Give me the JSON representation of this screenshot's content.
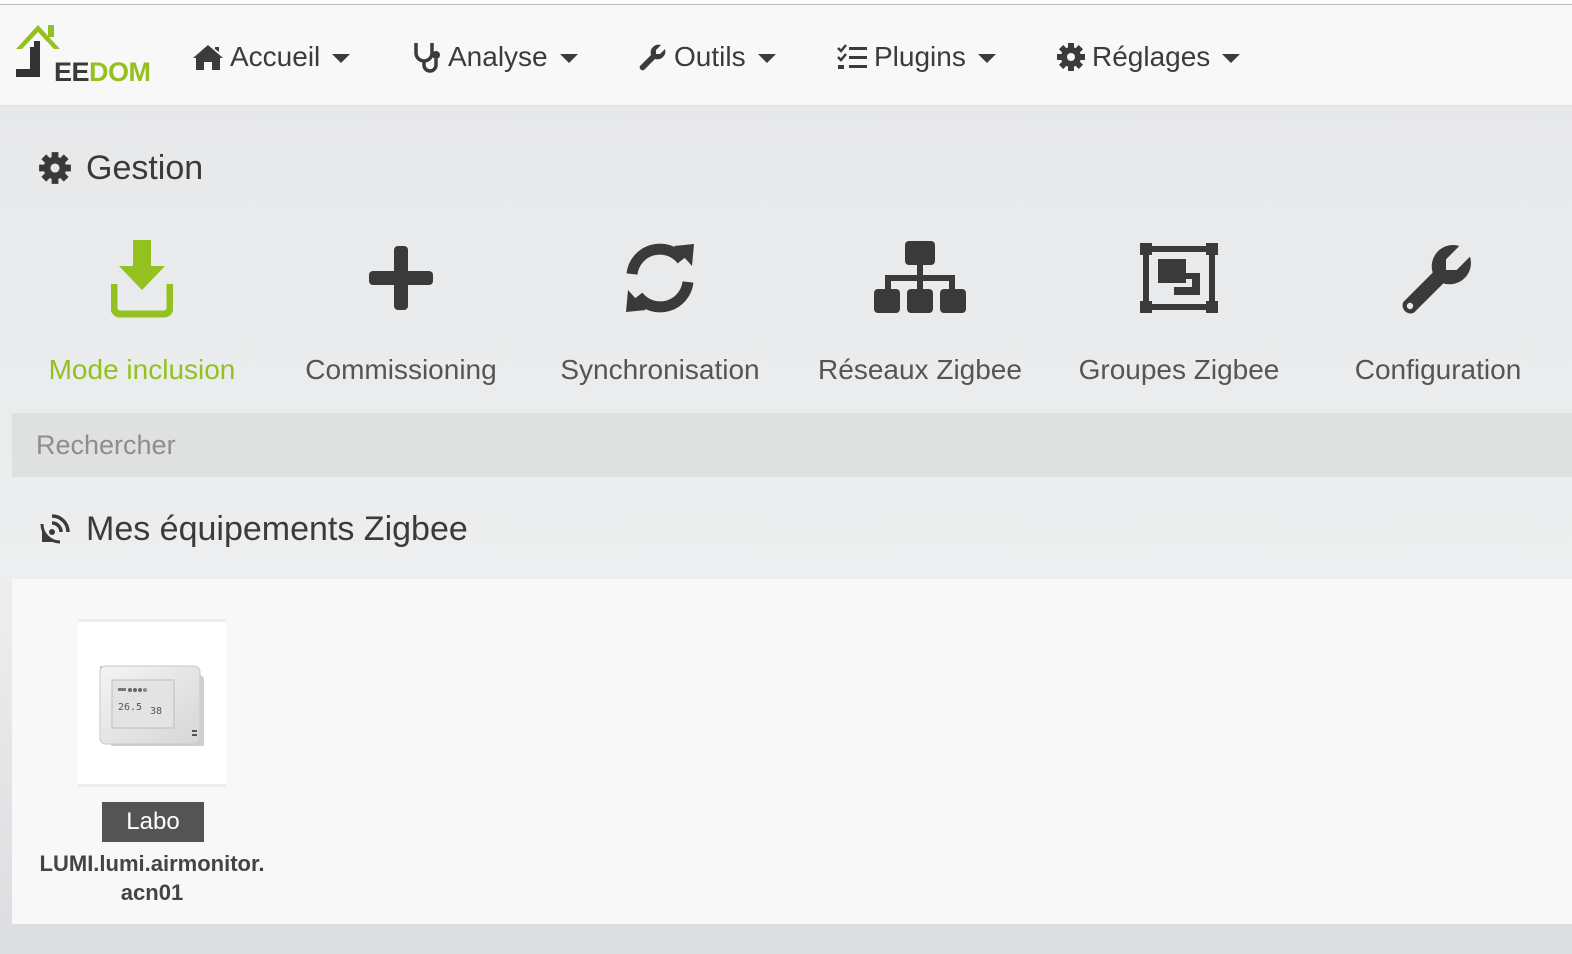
{
  "brand": {
    "logo_text_dark": "EE",
    "logo_text_green": "DOM",
    "colors": {
      "green": "#94c11f",
      "dark": "#3a3a3a"
    }
  },
  "nav": {
    "items": [
      {
        "label": "Accueil",
        "icon": "home-icon"
      },
      {
        "label": "Analyse",
        "icon": "stethoscope-icon"
      },
      {
        "label": "Outils",
        "icon": "wrench-icon"
      },
      {
        "label": "Plugins",
        "icon": "list-check-icon"
      },
      {
        "label": "Réglages",
        "icon": "gear-icon"
      }
    ]
  },
  "gestion": {
    "title": "Gestion",
    "actions": [
      {
        "label": "Mode inclusion",
        "icon": "download-icon"
      },
      {
        "label": "Commissioning",
        "icon": "plus-icon"
      },
      {
        "label": "Synchronisation",
        "icon": "sync-icon"
      },
      {
        "label": "Réseaux Zigbee",
        "icon": "sitemap-icon"
      },
      {
        "label": "Groupes Zigbee",
        "icon": "object-group-icon"
      },
      {
        "label": "Configuration",
        "icon": "wrench-icon"
      }
    ]
  },
  "search": {
    "placeholder": "Rechercher"
  },
  "equipments": {
    "title": "Mes équipements Zigbee",
    "items": [
      {
        "room": "Labo",
        "name_line1": "LUMI.lumi.airmonitor.",
        "name_line2": "acn01",
        "thumb_reading_1": "26.5",
        "thumb_reading_2": "38"
      }
    ]
  }
}
